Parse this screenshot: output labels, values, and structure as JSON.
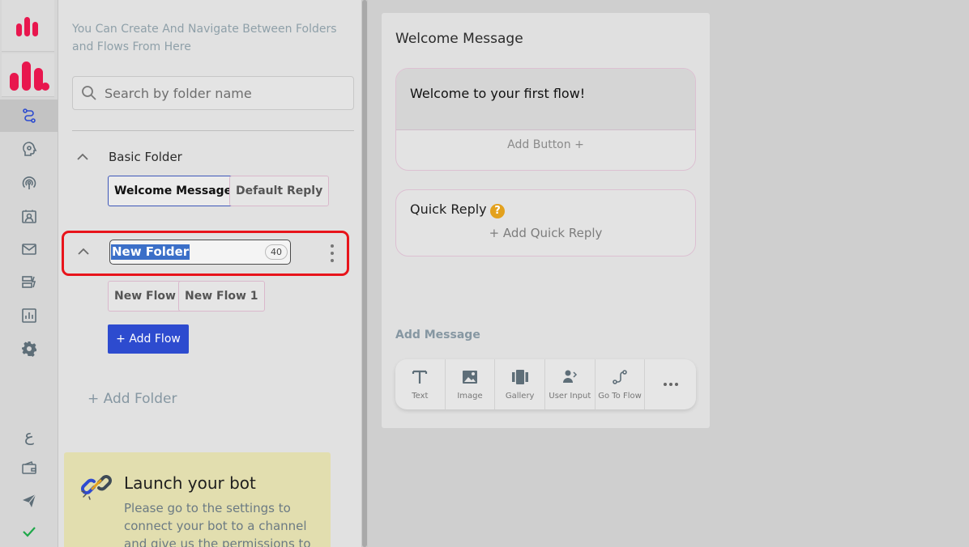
{
  "sidebar": {
    "items": [
      {
        "icon": "flow-icon",
        "active": true
      },
      {
        "icon": "brain-icon"
      },
      {
        "icon": "broadcast-icon"
      },
      {
        "icon": "contacts-icon"
      },
      {
        "icon": "mail-icon"
      },
      {
        "icon": "database-icon"
      },
      {
        "icon": "analytics-icon"
      },
      {
        "icon": "settings-icon"
      },
      {
        "icon": "language-icon",
        "label": "ع"
      },
      {
        "icon": "wallet-icon"
      },
      {
        "icon": "send-icon"
      },
      {
        "icon": "check-icon"
      }
    ],
    "brand_color": "#e8174e"
  },
  "folders_panel": {
    "hint": "You Can Create And Navigate Between Folders and Flows From Here",
    "search_placeholder": "Search by folder name",
    "folders": [
      {
        "name": "Basic Folder",
        "flows": [
          "Welcome Message",
          "Default Reply"
        ],
        "selected_flow": "Welcome Message"
      },
      {
        "name": "New Folder",
        "editing": true,
        "char_limit": "40",
        "flows": [
          "New Flow",
          "New Flow 1"
        ]
      }
    ],
    "add_flow_label": "+ Add Flow",
    "add_folder_label": "+ Add Folder",
    "launch": {
      "title": "Launch your bot",
      "body": "Please go to the settings to connect your bot to a channel and give us the permissions to"
    }
  },
  "preview": {
    "title": "Welcome Message",
    "message_text": "Welcome to your first flow!",
    "add_button_label": "Add Button +",
    "quick_reply_title": "Quick Reply",
    "quick_reply_help": "?",
    "add_quick_reply_label": "+ Add Quick Reply",
    "add_message_label": "Add Message",
    "tools": [
      {
        "label": "Text",
        "icon": "text-icon"
      },
      {
        "label": "Image",
        "icon": "image-icon"
      },
      {
        "label": "Gallery",
        "icon": "gallery-icon"
      },
      {
        "label": "User Input",
        "icon": "user-input-icon"
      },
      {
        "label": "Go To Flow",
        "icon": "go-to-flow-icon"
      },
      {
        "label": "",
        "icon": "more-icon"
      }
    ]
  },
  "colors": {
    "accent": "#2d4bcf",
    "highlight": "#e8141b",
    "help": "#e3a11d"
  }
}
